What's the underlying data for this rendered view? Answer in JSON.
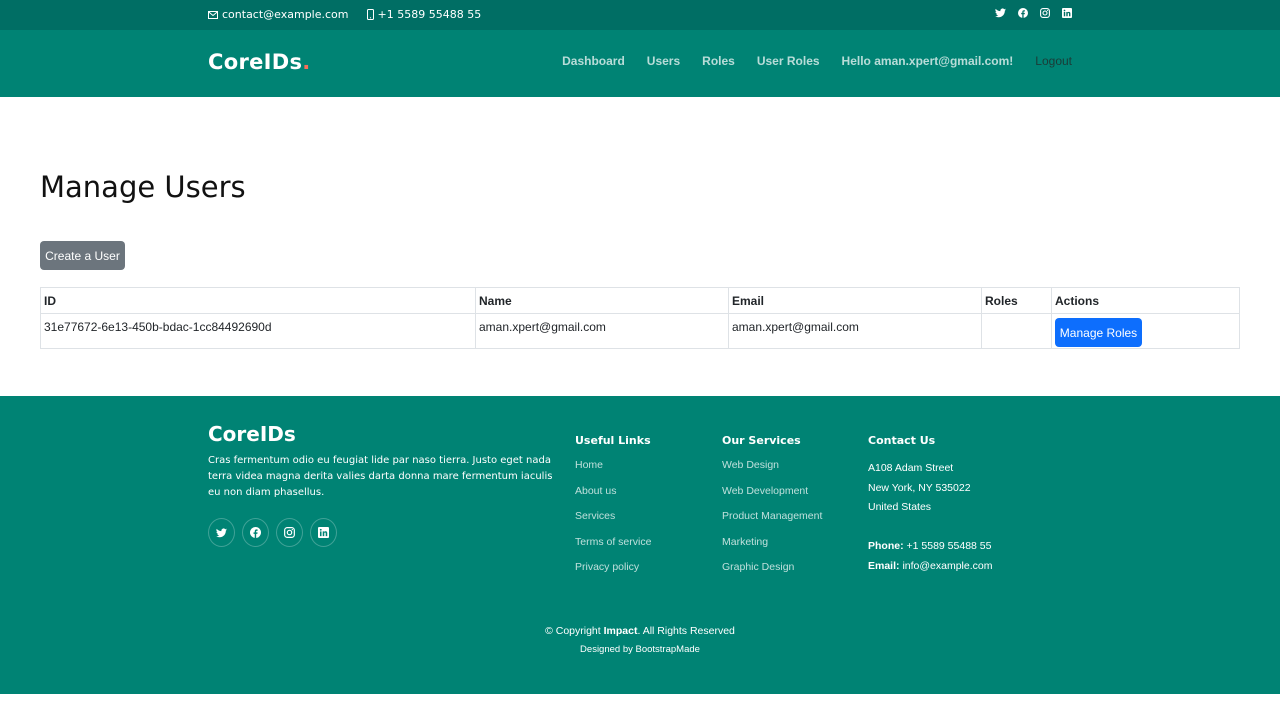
{
  "topbar": {
    "email": "contact@example.com",
    "phone": "+1 5589 55488 55",
    "social": [
      "twitter-icon",
      "facebook-icon",
      "instagram-icon",
      "linkedin-icon"
    ]
  },
  "header": {
    "logo": "CoreIDs",
    "logo_dot": ".",
    "nav": {
      "dashboard": "Dashboard",
      "users": "Users",
      "roles": "Roles",
      "user_roles": "User Roles",
      "hello": "Hello aman.xpert@gmail.com!",
      "logout": "Logout"
    }
  },
  "main": {
    "title": "Manage Users",
    "create_button": "Create a User",
    "table": {
      "headers": [
        "ID",
        "Name",
        "Email",
        "Roles",
        "Actions"
      ],
      "rows": [
        {
          "id": "31e77672-6e13-450b-bdac-1cc84492690d",
          "name": "aman.xpert@gmail.com",
          "email": "aman.xpert@gmail.com",
          "roles": "",
          "action": "Manage Roles"
        }
      ]
    }
  },
  "footer": {
    "logo": "CoreIDs",
    "description": "Cras fermentum odio eu feugiat lide par naso tierra. Justo eget nada terra videa magna derita valies darta donna mare fermentum iaculis eu non diam phasellus.",
    "useful_links": {
      "title": "Useful Links",
      "items": [
        "Home",
        "About us",
        "Services",
        "Terms of service",
        "Privacy policy"
      ]
    },
    "services": {
      "title": "Our Services",
      "items": [
        "Web Design",
        "Web Development",
        "Product Management",
        "Marketing",
        "Graphic Design"
      ]
    },
    "contact": {
      "title": "Contact Us",
      "street": "A108 Adam Street",
      "city": "New York, NY 535022",
      "country": "United States",
      "phone_label": "Phone:",
      "phone": "+1 5589 55488 55",
      "email_label": "Email:",
      "email": "info@example.com"
    },
    "copyright_prefix": "© Copyright",
    "copyright_brand": "Impact",
    "copyright_suffix": ". All Rights Reserved",
    "designed_by": "Designed by BootstrapMade"
  },
  "colors": {
    "topbar": "#006e64",
    "header": "#008374",
    "accent_dot": "#f96f59",
    "primary_button": "#0d6efd",
    "secondary_button": "#6c757d"
  }
}
